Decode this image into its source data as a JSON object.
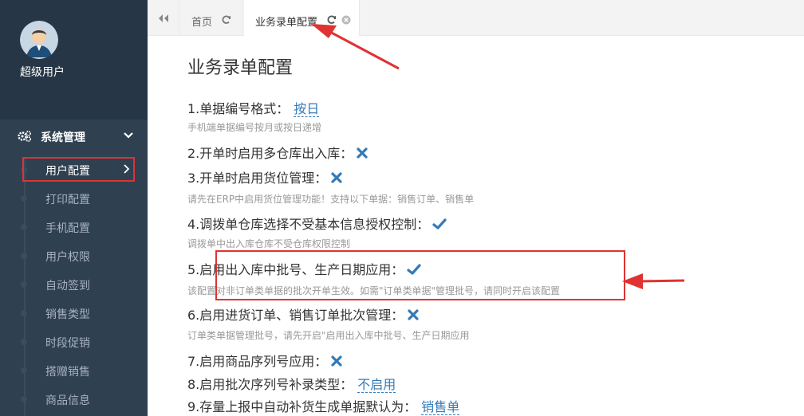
{
  "user": {
    "name": "超级用户"
  },
  "sidebar": {
    "section_title": "系统管理",
    "items": [
      {
        "label": "用户配置",
        "active": true
      },
      {
        "label": "打印配置"
      },
      {
        "label": "手机配置"
      },
      {
        "label": "用户权限"
      },
      {
        "label": "自动签到"
      },
      {
        "label": "销售类型"
      },
      {
        "label": "时段促销"
      },
      {
        "label": "搭赠销售"
      },
      {
        "label": "商品信息"
      }
    ]
  },
  "tabs": [
    {
      "label": "首页"
    },
    {
      "label": "业务录单配置",
      "active": true
    }
  ],
  "page": {
    "title": "业务录单配置",
    "settings": [
      {
        "label": "1.单据编号格式：",
        "value": "按日",
        "hint": "手机端单据编号按月或按日递增"
      },
      {
        "label": "2.开单时启用多仓库出入库：",
        "state": "off"
      },
      {
        "label": "3.开单时启用货位管理：",
        "state": "off",
        "hint": "请先在ERP中启用货位管理功能！支持以下单据：销售订单、销售单"
      },
      {
        "label": "4.调拨单仓库选择不受基本信息授权控制：",
        "state": "on",
        "hint": "调拨单中出入库仓库不受仓库权限控制"
      },
      {
        "label": "5.启用出入库中批号、生产日期应用：",
        "state": "on",
        "hint": "该配置对非订单类单据的批次开单生效。如需\"订单类单据\"管理批号，请同时开启该配置"
      },
      {
        "label": "6.启用进货订单、销售订单批次管理：",
        "state": "off",
        "hint": "订单类单据管理批号，请先开启\"启用出入库中批号、生产日期应用"
      },
      {
        "label": "7.启用商品序列号应用：",
        "state": "off"
      },
      {
        "label": "8.启用批次序列号补录类型：",
        "value": "不启用"
      },
      {
        "label": "9.存量上报中自动补货生成单据默认为：",
        "value": "销售单"
      }
    ]
  },
  "colors": {
    "accent_link": "#337ab7",
    "check": "#337ab7",
    "annotation": "#e03232",
    "sidebar_bg": "#2f4050"
  }
}
